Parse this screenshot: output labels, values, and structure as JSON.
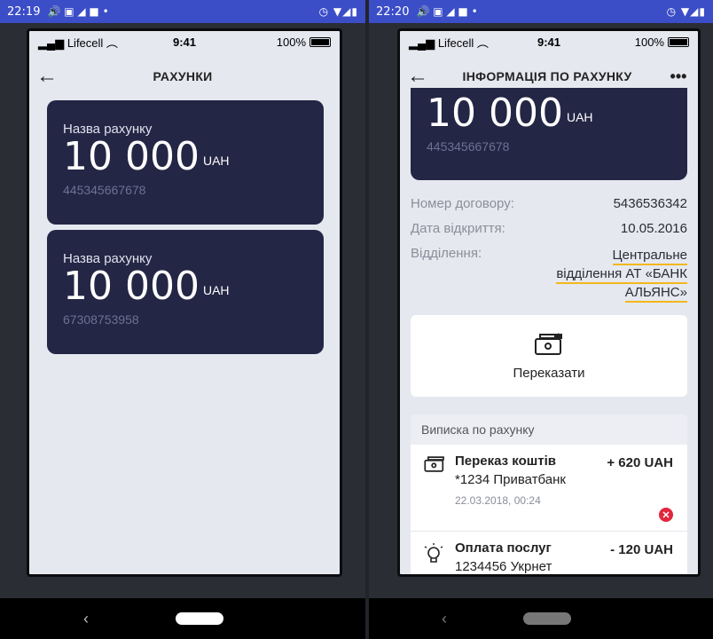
{
  "left": {
    "android_status": {
      "time": "22:19",
      "indicators": "🔊 ▣ ◢ ■ •",
      "right_icons": "◷ ▼◢▮"
    },
    "ios_status": {
      "carrier": "Lifecell",
      "time": "9:41",
      "battery": "100%"
    },
    "nav": {
      "title": "РАХУНКИ"
    },
    "accounts": [
      {
        "name": "Назва рахунку",
        "amount": "10 000",
        "currency": "UAH",
        "number": "445345667678"
      },
      {
        "name": "Назва рахунку",
        "amount": "10 000",
        "currency": "UAH",
        "number": "67308753958"
      }
    ]
  },
  "right": {
    "android_status": {
      "time": "22:20",
      "indicators": "🔊 ▣ ◢ ■ •",
      "right_icons": "◷ ▼◢▮"
    },
    "ios_status": {
      "carrier": "Lifecell",
      "time": "9:41",
      "battery": "100%"
    },
    "nav": {
      "title": "ІНФОРМАЦІЯ ПО РАХУНКУ",
      "more": "•••"
    },
    "account": {
      "amount": "10 000",
      "currency": "UAH",
      "number": "445345667678"
    },
    "details": {
      "contract_label": "Номер договору:",
      "contract_value": "5436536342",
      "opened_label": "Дата відкриття:",
      "opened_value": "10.05.2016",
      "branch_label": "Відділення:",
      "branch_line1": "Центральне",
      "branch_line2": "відділення АТ «БАНК",
      "branch_line3": "АЛЬЯНС»"
    },
    "transfer_label": "Переказати",
    "statement": {
      "header": "Виписка по рахунку",
      "transactions": [
        {
          "title": "Переказ коштів",
          "amount": "+ 620 UAH",
          "sub": "*1234 Приватбанк",
          "date": "22.03.2018, 00:24",
          "icon": "money-transfer-icon",
          "status": "✕"
        },
        {
          "title": "Оплата послуг",
          "amount": "- 120 UAH",
          "sub": "1234456 Укрнет",
          "icon": "lightbulb-icon"
        }
      ]
    }
  },
  "colors": {
    "card": "#242645",
    "accent": "#f2b81a",
    "android_bar": "#3b4ec8",
    "error": "#e2263d"
  }
}
